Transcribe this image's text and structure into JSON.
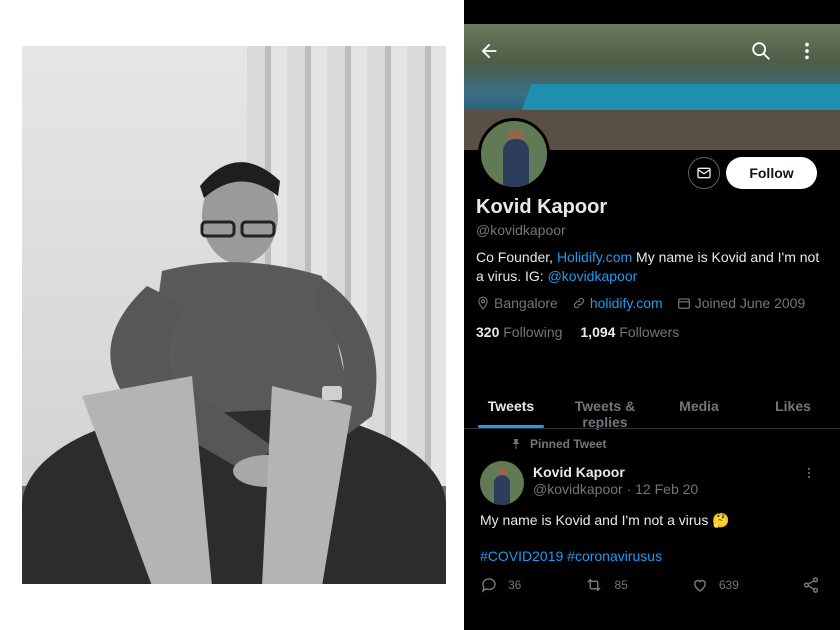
{
  "profile": {
    "display_name": "Kovid Kapoor",
    "handle": "@kovidkapoor",
    "follow_label": "Follow",
    "bio_prefix": "Co Founder, ",
    "bio_link": "Holidify.com",
    "bio_middle": " My name is Kovid and I'm not a virus. IG: ",
    "bio_ig": "@kovidkapoor",
    "location": "Bangalore",
    "website": "holidify.com",
    "joined": "Joined June 2009",
    "following_count": "320",
    "following_label": "Following",
    "followers_count": "1,094",
    "followers_label": "Followers"
  },
  "header": {
    "back_icon": "arrow-left-icon",
    "search_icon": "search-icon",
    "more_icon": "more-vertical-icon"
  },
  "tabs": [
    {
      "label": "Tweets",
      "active": true
    },
    {
      "label": "Tweets & replies",
      "active": false
    },
    {
      "label": "Media",
      "active": false
    },
    {
      "label": "Likes",
      "active": false
    }
  ],
  "tweet": {
    "pinned_label": "Pinned Tweet",
    "author": "Kovid Kapoor",
    "sub": "@kovidkapoor · 12 Feb 20",
    "text": "My name is Kovid and I'm not a virus 🤔",
    "hashtags": "#COVID2019 #coronavirusus",
    "replies": "36",
    "retweets": "85",
    "likes": "639"
  },
  "colors": {
    "accent": "#1d9bf0",
    "background": "#000000",
    "muted": "#71767b"
  }
}
